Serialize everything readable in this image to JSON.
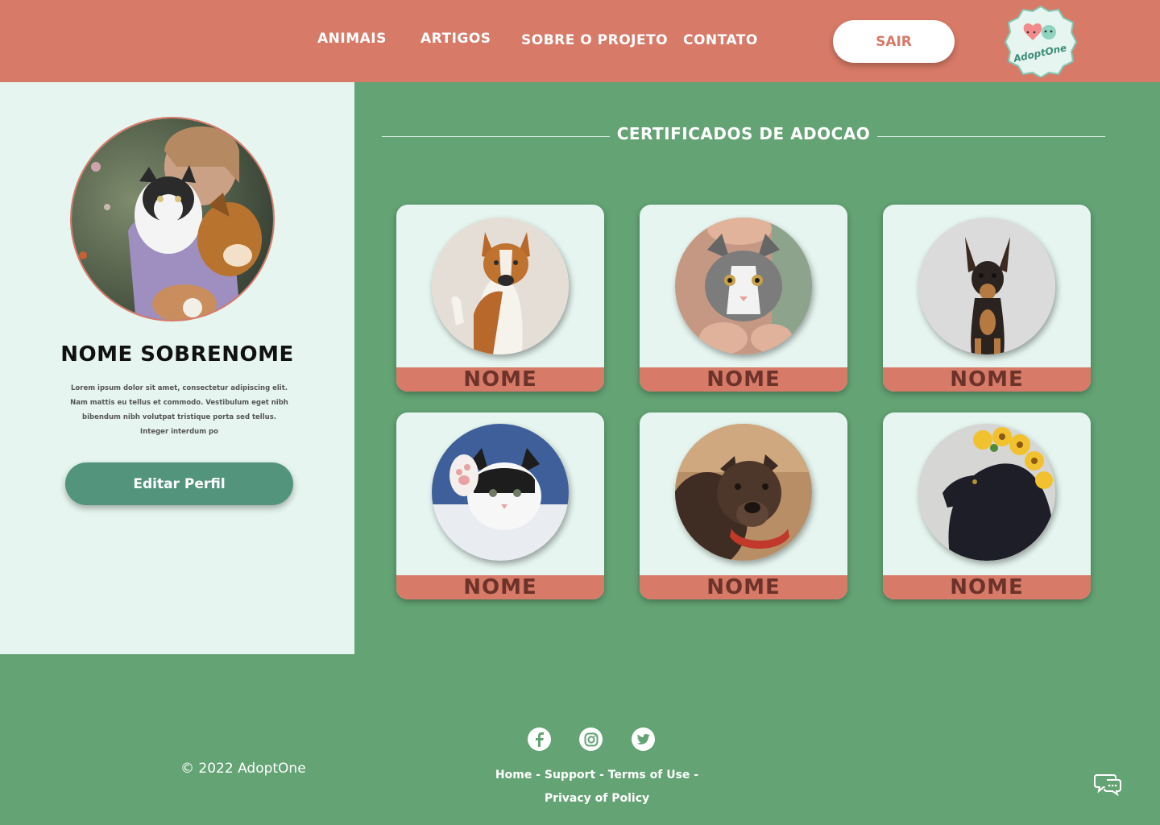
{
  "header": {
    "nav": [
      {
        "label": "ANIMAIS"
      },
      {
        "label": "ARTIGOS"
      },
      {
        "label": "SOBRE O PROJETO"
      },
      {
        "label": "CONTATO"
      }
    ],
    "logout_label": "SAIR",
    "logo_text": "AdoptOne"
  },
  "profile": {
    "name": "NOME SOBRENOME",
    "bio": "Lorem ipsum dolor sit amet, consectetur adipiscing elit. Nam mattis eu tellus et commodo. Vestibulum eget nibh bibendum nibh volutpat tristique porta sed tellus. Integer interdum po",
    "edit_label": "Editar Perfil"
  },
  "certificates": {
    "title": "CERTIFICADOS DE ADOCAO",
    "cards": [
      {
        "label": "NOME",
        "animal": "dog"
      },
      {
        "label": "NOME",
        "animal": "cat"
      },
      {
        "label": "NOME",
        "animal": "dog"
      },
      {
        "label": "NOME",
        "animal": "cat"
      },
      {
        "label": "NOME",
        "animal": "dog"
      },
      {
        "label": "NOME",
        "animal": "cat"
      }
    ]
  },
  "footer": {
    "copyright": "© 2022 AdoptOne",
    "links": [
      {
        "label": "Home"
      },
      {
        "label": "Support"
      },
      {
        "label": "Terms of Use"
      },
      {
        "label": "Privacy of Policy"
      }
    ],
    "social": [
      "facebook-icon",
      "instagram-icon",
      "twitter-icon"
    ]
  },
  "colors": {
    "header": "#d87a68",
    "page": "#63a374",
    "panel": "#e6f5ef",
    "button": "#52947c",
    "label_text": "#6b3329"
  }
}
